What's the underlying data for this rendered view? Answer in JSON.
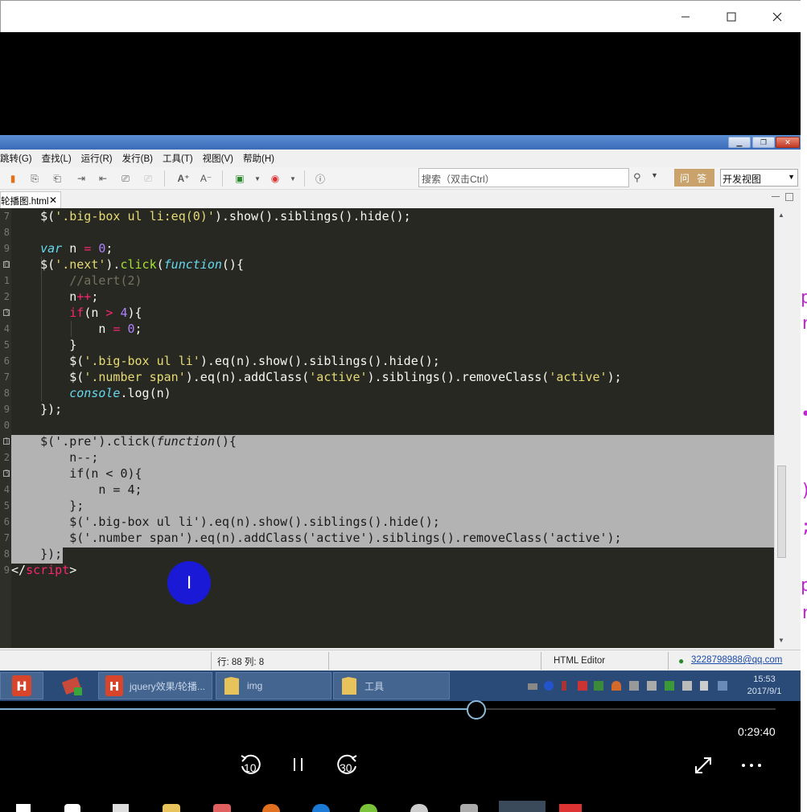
{
  "window": {
    "minimize_icon": "minimize-icon",
    "maximize_icon": "maximize-icon",
    "close_icon": "close-icon"
  },
  "ide": {
    "menus": [
      "跳转(G)",
      "查找(L)",
      "运行(R)",
      "发行(B)",
      "工具(T)",
      "视图(V)",
      "帮助(H)"
    ],
    "search_placeholder": "搜索（双击Ctrl）",
    "ask_label": "问 答",
    "view_select": "开发视图",
    "file_tab": "轮播图.html",
    "file_tab_close": "✕",
    "status_position": "行: 88 列: 8",
    "status_editor": "HTML Editor",
    "status_user": "3228798988@qq.com",
    "code_lines": [
      {
        "n": "7",
        "fold": false
      },
      {
        "n": "8",
        "fold": false
      },
      {
        "n": "9",
        "fold": false
      },
      {
        "n": "0",
        "fold": true
      },
      {
        "n": "1",
        "fold": false
      },
      {
        "n": "2",
        "fold": false
      },
      {
        "n": "3",
        "fold": true
      },
      {
        "n": "4",
        "fold": false
      },
      {
        "n": "5",
        "fold": false
      },
      {
        "n": "6",
        "fold": false
      },
      {
        "n": "7",
        "fold": false
      },
      {
        "n": "8",
        "fold": false
      },
      {
        "n": "9",
        "fold": false
      },
      {
        "n": "0",
        "fold": false
      },
      {
        "n": "1",
        "fold": true
      },
      {
        "n": "2",
        "fold": false
      },
      {
        "n": "3",
        "fold": true
      },
      {
        "n": "4",
        "fold": false
      },
      {
        "n": "5",
        "fold": false
      },
      {
        "n": "6",
        "fold": false
      },
      {
        "n": "7",
        "fold": false
      },
      {
        "n": "8",
        "fold": false
      },
      {
        "n": "9",
        "fold": false
      }
    ]
  },
  "taskbar": {
    "tasks": [
      "jquery效果/轮播...",
      "img",
      "工具"
    ],
    "clock_time": "15:53",
    "clock_date": "2017/9/1"
  },
  "player": {
    "progress": 0.614,
    "time": "0:29:40",
    "rewind_label": "10",
    "forward_label": "30",
    "pause_icon": "pause-icon",
    "fullscreen_icon": "fullscreen-icon",
    "more_icon": "more-icon"
  },
  "colors": {
    "editor_bg": "#272822",
    "selection": "#b3b3b3",
    "keyword": "#66d9ef",
    "string": "#e6db74",
    "operator": "#f92672",
    "number": "#ae81ff",
    "method": "#a6e22e",
    "comment": "#75715e",
    "progress_fill": "#7fb3d5"
  }
}
